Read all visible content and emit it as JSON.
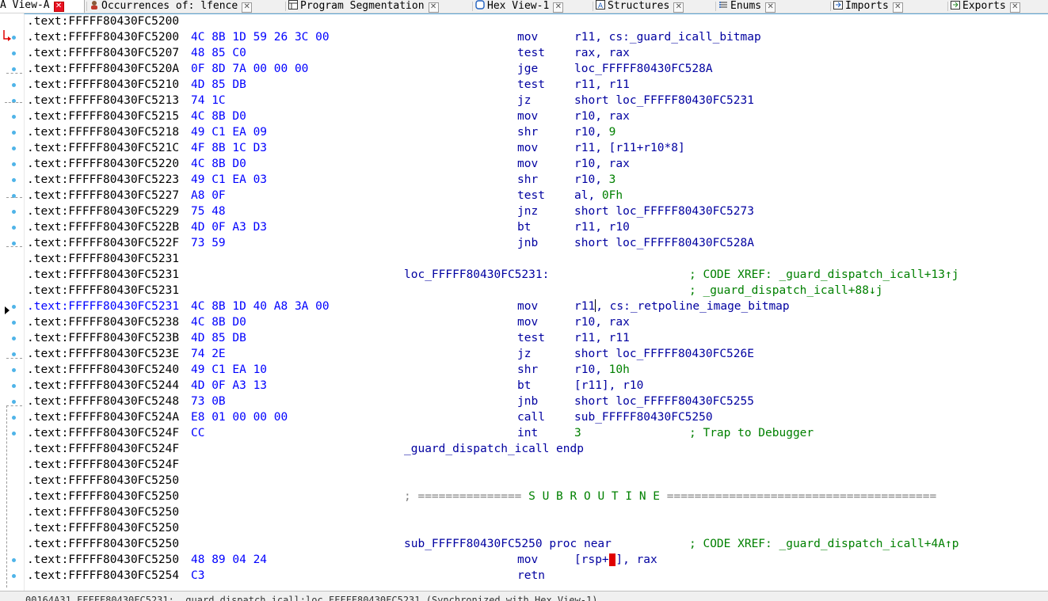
{
  "tabs": [
    {
      "label": "A View-A",
      "icon": "none",
      "active": true
    },
    {
      "label": "Occurrences of: lfence",
      "icon": "person-icon"
    },
    {
      "label": "Program Segmentation",
      "icon": "grid-icon"
    },
    {
      "label": "Hex View-1",
      "icon": "hex-icon"
    },
    {
      "label": "Structures",
      "icon": "structure-icon"
    },
    {
      "label": "Enums",
      "icon": "enum-icon"
    },
    {
      "label": "Imports",
      "icon": "import-icon"
    },
    {
      "label": "Exports",
      "icon": "export-icon"
    }
  ],
  "listing": [
    {
      "addr": ".text:FFFFF80430FC5200",
      "bytes": "",
      "label": "",
      "mnem": "",
      "ops": "",
      "cmt": ""
    },
    {
      "addr": ".text:FFFFF80430FC5200",
      "bytes": "4C 8B 1D 59 26 3C 00",
      "mnem": "mov",
      "ops": "r11, cs:_guard_icall_bitmap"
    },
    {
      "addr": ".text:FFFFF80430FC5207",
      "bytes": "48 85 C0",
      "mnem": "test",
      "ops": "rax, rax"
    },
    {
      "addr": ".text:FFFFF80430FC520A",
      "bytes": "0F 8D 7A 00 00 00",
      "mnem": "jge",
      "ops": "loc_FFFFF80430FC528A"
    },
    {
      "addr": ".text:FFFFF80430FC5210",
      "bytes": "4D 85 DB",
      "mnem": "test",
      "ops": "r11, r11"
    },
    {
      "addr": ".text:FFFFF80430FC5213",
      "bytes": "74 1C",
      "mnem": "jz",
      "ops": "short loc_FFFFF80430FC5231"
    },
    {
      "addr": ".text:FFFFF80430FC5215",
      "bytes": "4C 8B D0",
      "mnem": "mov",
      "ops": "r10, rax"
    },
    {
      "addr": ".text:FFFFF80430FC5218",
      "bytes": "49 C1 EA 09",
      "mnem": "shr",
      "ops": "r10, ",
      "num": "9"
    },
    {
      "addr": ".text:FFFFF80430FC521C",
      "bytes": "4F 8B 1C D3",
      "mnem": "mov",
      "ops": "r11, [r11+r10*8]"
    },
    {
      "addr": ".text:FFFFF80430FC5220",
      "bytes": "4C 8B D0",
      "mnem": "mov",
      "ops": "r10, rax"
    },
    {
      "addr": ".text:FFFFF80430FC5223",
      "bytes": "49 C1 EA 03",
      "mnem": "shr",
      "ops": "r10, ",
      "num": "3"
    },
    {
      "addr": ".text:FFFFF80430FC5227",
      "bytes": "A8 0F",
      "mnem": "test",
      "ops": "al, ",
      "num": "0Fh"
    },
    {
      "addr": ".text:FFFFF80430FC5229",
      "bytes": "75 48",
      "mnem": "jnz",
      "ops": "short loc_FFFFF80430FC5273"
    },
    {
      "addr": ".text:FFFFF80430FC522B",
      "bytes": "4D 0F A3 D3",
      "mnem": "bt",
      "ops": "r11, r10"
    },
    {
      "addr": ".text:FFFFF80430FC522F",
      "bytes": "73 59",
      "mnem": "jnb",
      "ops": "short loc_FFFFF80430FC528A"
    },
    {
      "addr": ".text:FFFFF80430FC5231"
    },
    {
      "addr": ".text:FFFFF80430FC5231",
      "label": "loc_FFFFF80430FC5231:",
      "cmt": "; CODE XREF: _guard_dispatch_icall+13↑j"
    },
    {
      "addr": ".text:FFFFF80430FC5231",
      "cmt": "; _guard_dispatch_icall+88↓j"
    },
    {
      "addr": ".text:FFFFF80430FC5231",
      "bytes": "4C 8B 1D 40 A8 3A 00",
      "mnem": "mov",
      "ops_pre": "r11",
      "ops_post": ", cs:_retpoline_image_bitmap",
      "current": true
    },
    {
      "addr": ".text:FFFFF80430FC5238",
      "bytes": "4C 8B D0",
      "mnem": "mov",
      "ops": "r10, rax"
    },
    {
      "addr": ".text:FFFFF80430FC523B",
      "bytes": "4D 85 DB",
      "mnem": "test",
      "ops": "r11, r11"
    },
    {
      "addr": ".text:FFFFF80430FC523E",
      "bytes": "74 2E",
      "mnem": "jz",
      "ops": "short loc_FFFFF80430FC526E"
    },
    {
      "addr": ".text:FFFFF80430FC5240",
      "bytes": "49 C1 EA 10",
      "mnem": "shr",
      "ops": "r10, ",
      "num": "10h"
    },
    {
      "addr": ".text:FFFFF80430FC5244",
      "bytes": "4D 0F A3 13",
      "mnem": "bt",
      "ops": "[r11], r10"
    },
    {
      "addr": ".text:FFFFF80430FC5248",
      "bytes": "73 0B",
      "mnem": "jnb",
      "ops": "short loc_FFFFF80430FC5255"
    },
    {
      "addr": ".text:FFFFF80430FC524A",
      "bytes": "E8 01 00 00 00",
      "mnem": "call",
      "ops": "sub_FFFFF80430FC5250"
    },
    {
      "addr": ".text:FFFFF80430FC524F",
      "bytes": "CC",
      "mnem": "int",
      "num": "3",
      "cmt": "; Trap to Debugger"
    },
    {
      "addr": ".text:FFFFF80430FC524F",
      "label": "_guard_dispatch_icall endp"
    },
    {
      "addr": ".text:FFFFF80430FC524F"
    },
    {
      "addr": ".text:FFFFF80430FC5250"
    },
    {
      "addr": ".text:FFFFF80430FC5250",
      "sep_pre": "; =============== ",
      "sep_word": "S U B R O U T I N E",
      "sep_post": " ======================================="
    },
    {
      "addr": ".text:FFFFF80430FC5250"
    },
    {
      "addr": ".text:FFFFF80430FC5250"
    },
    {
      "addr": ".text:FFFFF80430FC5250",
      "label": "sub_FFFFF80430FC5250 proc near",
      "cmt": "; CODE XREF: _guard_dispatch_icall+4A↑p"
    },
    {
      "addr": ".text:FFFFF80430FC5250",
      "bytes": "48 89 04 24",
      "mnem": "mov",
      "ops_pre": "[rsp+",
      "hl": "0",
      "ops_post": "], rax"
    },
    {
      "addr": ".text:FFFFF80430FC5254",
      "bytes": "C3",
      "mnem": "retn"
    }
  ],
  "status": "00164A31 FFFFF80430FC5231: _guard_dispatch_icall:loc_FFFFF80430FC5231 (Synchronized with Hex View-1)"
}
